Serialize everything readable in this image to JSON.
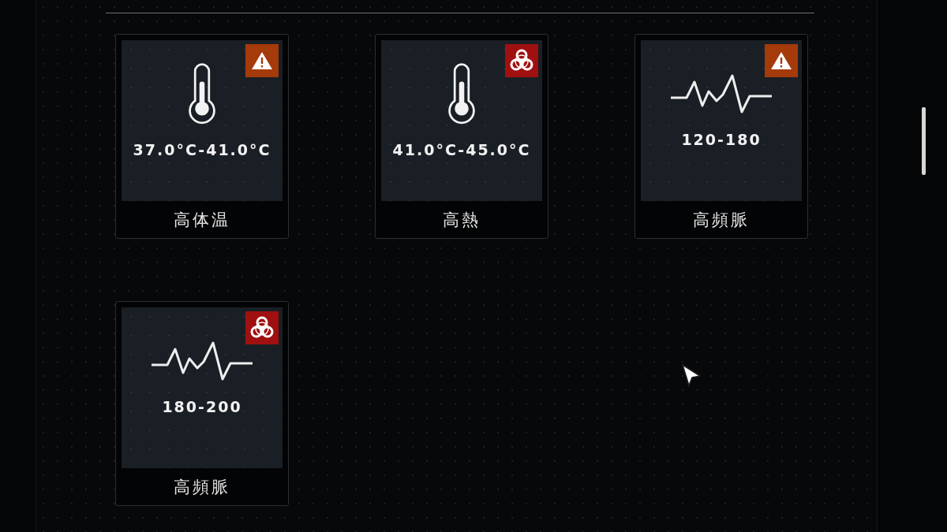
{
  "cards": [
    {
      "kind": "temperature",
      "badge": {
        "kind": "warning",
        "color": "#a53a0a"
      },
      "range": "37.0°C-41.0°C",
      "label": "高体温"
    },
    {
      "kind": "temperature",
      "badge": {
        "kind": "biohazard",
        "color": "#a01010"
      },
      "range": "41.0°C-45.0°C",
      "label": "高熱"
    },
    {
      "kind": "pulse",
      "badge": {
        "kind": "warning",
        "color": "#a53a0a"
      },
      "range": "120-180",
      "label": "高頻脈"
    },
    {
      "kind": "pulse",
      "badge": {
        "kind": "biohazard",
        "color": "#a01010"
      },
      "range": "180-200",
      "label": "高頻脈"
    }
  ]
}
